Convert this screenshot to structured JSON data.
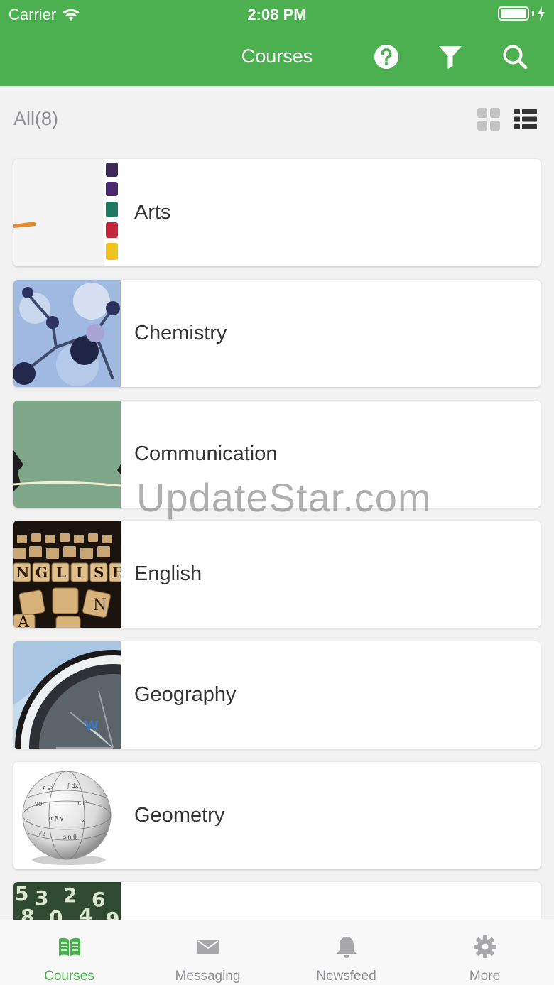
{
  "status_bar": {
    "carrier": "Carrier",
    "time": "2:08 PM"
  },
  "header": {
    "title": "Courses",
    "accent": "#4caf50"
  },
  "toolbar": {
    "count_label": "All(8)"
  },
  "courses": [
    {
      "name": "Arts",
      "thumb": "paint-palette-image"
    },
    {
      "name": "Chemistry",
      "thumb": "molecule-model-image"
    },
    {
      "name": "Communication",
      "thumb": "speaking-silhouette-image"
    },
    {
      "name": "English",
      "thumb": "letter-cubes-image"
    },
    {
      "name": "Geography",
      "thumb": "compass-image"
    },
    {
      "name": "Geometry",
      "thumb": "formula-sphere-image"
    },
    {
      "name": "",
      "thumb": "numbers-image"
    }
  ],
  "watermark": "UpdateStar.com",
  "tabs": [
    {
      "label": "Courses",
      "icon": "book-icon",
      "active": true
    },
    {
      "label": "Messaging",
      "icon": "envelope-icon",
      "active": false
    },
    {
      "label": "Newsfeed",
      "icon": "bell-icon",
      "active": false
    },
    {
      "label": "More",
      "icon": "gear-icon",
      "active": false
    }
  ]
}
